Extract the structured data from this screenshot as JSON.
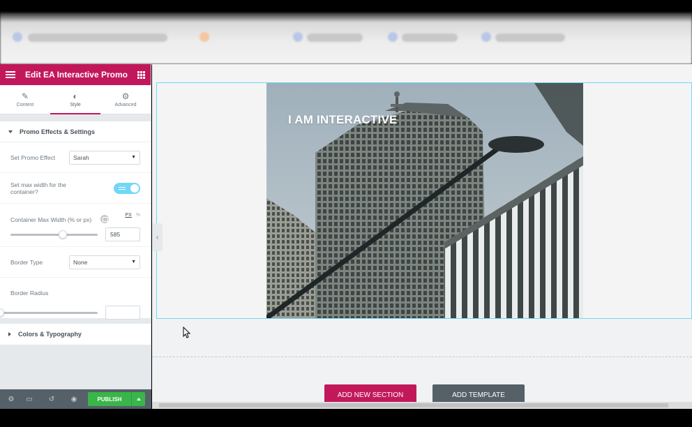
{
  "panel": {
    "title": "Edit EA Interactive Promo",
    "tabs": [
      {
        "label": "Content",
        "icon": "pencil-icon"
      },
      {
        "label": "Style",
        "icon": "contrast-icon"
      },
      {
        "label": "Advanced",
        "icon": "gear-icon"
      }
    ],
    "active_tab": "Style",
    "section_promo": {
      "title": "Promo Effects & Settings",
      "promo_effect_label": "Set Promo Effect",
      "promo_effect_value": "Sarah",
      "max_width_label": "Set max width for the container?",
      "max_width_enabled": true,
      "container_width_label": "Container Max Width (% or px)",
      "unit_px": "PX",
      "unit_pct": "%",
      "container_width_value": "585",
      "container_width_fraction": 0.6,
      "border_type_label": "Border Type",
      "border_type_value": "None",
      "border_radius_label": "Border Radius",
      "border_radius_value": "",
      "border_radius_fraction": 0
    },
    "section_colors": {
      "title": "Colors & Typography"
    },
    "footer": {
      "publish_label": "PUBLISH"
    }
  },
  "canvas": {
    "promo_title": "I AM INTERACTIVE",
    "add_section_label": "ADD NEW SECTION",
    "add_template_label": "ADD TEMPLATE"
  },
  "colors": {
    "accent": "#c2185b",
    "publish_green": "#39b54a",
    "selection_blue": "#71d7f7",
    "footer_gray": "#556068"
  }
}
